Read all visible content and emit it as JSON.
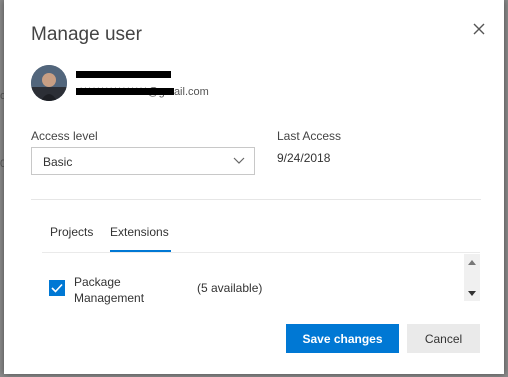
{
  "backdrop": {
    "fragment_a": "o",
    "fragment_b": "0"
  },
  "dialog": {
    "title": "Manage user",
    "user": {
      "name": "*** ****** ******",
      "email": "****************@gmail.com"
    },
    "access_level": {
      "label": "Access level",
      "selected": "Basic"
    },
    "last_access": {
      "label": "Last Access",
      "value": "9/24/2018"
    },
    "tabs": [
      {
        "label": "Projects"
      },
      {
        "label": "Extensions"
      }
    ],
    "extension": {
      "name": "Package Management",
      "availability": "(5 available)",
      "checked": true
    },
    "buttons": {
      "save": "Save changes",
      "cancel": "Cancel"
    }
  },
  "colors": {
    "accent": "#0078d4",
    "backdrop": "#8a8a8a"
  },
  "icons": {
    "close": "close-icon",
    "dropdown": "chevron-down-icon",
    "check": "checkmark-icon"
  }
}
